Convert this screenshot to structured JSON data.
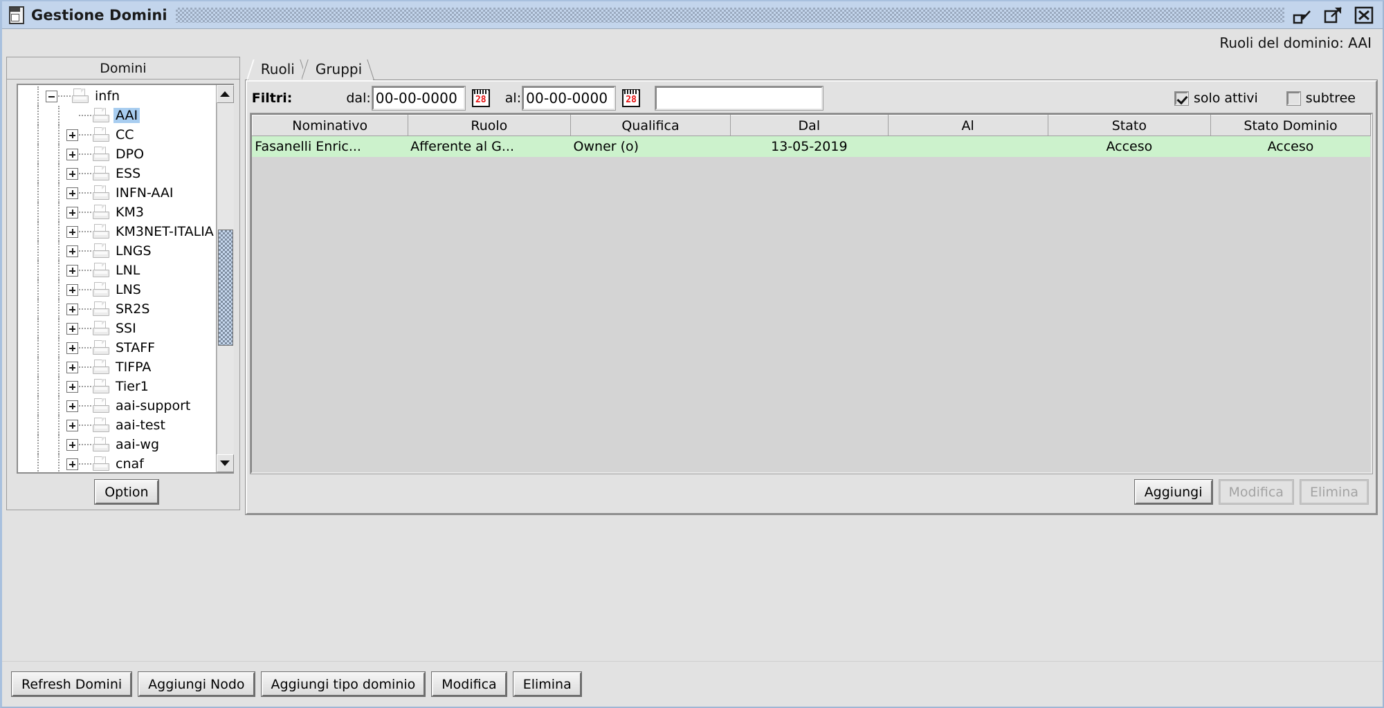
{
  "window": {
    "title": "Gestione Domini",
    "icon": "window-app-icon",
    "controls": [
      {
        "name": "minimize-icon",
        "label": "Minimize"
      },
      {
        "name": "maximize-icon",
        "label": "Maximize"
      },
      {
        "name": "close-icon",
        "label": "Close"
      }
    ]
  },
  "header": {
    "context_label": "Ruoli del dominio: AAI"
  },
  "left_panel": {
    "title": "Domini",
    "option_button": "Option",
    "tree": [
      {
        "label": "infn",
        "level": 0,
        "toggle": "minus",
        "selected": false
      },
      {
        "label": "AAI",
        "level": 1,
        "toggle": "none",
        "selected": true
      },
      {
        "label": "CC",
        "level": 1,
        "toggle": "plus",
        "selected": false
      },
      {
        "label": "DPO",
        "level": 1,
        "toggle": "plus",
        "selected": false
      },
      {
        "label": "ESS",
        "level": 1,
        "toggle": "plus",
        "selected": false
      },
      {
        "label": "INFN-AAI",
        "level": 1,
        "toggle": "plus",
        "selected": false
      },
      {
        "label": "KM3",
        "level": 1,
        "toggle": "plus",
        "selected": false
      },
      {
        "label": "KM3NET-ITALIA",
        "level": 1,
        "toggle": "plus",
        "selected": false
      },
      {
        "label": "LNGS",
        "level": 1,
        "toggle": "plus",
        "selected": false
      },
      {
        "label": "LNL",
        "level": 1,
        "toggle": "plus",
        "selected": false
      },
      {
        "label": "LNS",
        "level": 1,
        "toggle": "plus",
        "selected": false
      },
      {
        "label": "SR2S",
        "level": 1,
        "toggle": "plus",
        "selected": false
      },
      {
        "label": "SSI",
        "level": 1,
        "toggle": "plus",
        "selected": false
      },
      {
        "label": "STAFF",
        "level": 1,
        "toggle": "plus",
        "selected": false
      },
      {
        "label": "TIFPA",
        "level": 1,
        "toggle": "plus",
        "selected": false
      },
      {
        "label": "Tier1",
        "level": 1,
        "toggle": "plus",
        "selected": false
      },
      {
        "label": "aai-support",
        "level": 1,
        "toggle": "plus",
        "selected": false
      },
      {
        "label": "aai-test",
        "level": 1,
        "toggle": "plus",
        "selected": false
      },
      {
        "label": "aai-wg",
        "level": 1,
        "toggle": "plus",
        "selected": false
      },
      {
        "label": "cnaf",
        "level": 1,
        "toggle": "plus",
        "selected": false
      }
    ]
  },
  "right_panel": {
    "tabs": [
      {
        "label": "Ruoli",
        "active": true
      },
      {
        "label": "Gruppi",
        "active": false
      }
    ],
    "filters": {
      "title": "Filtri:",
      "from_label": "dal:",
      "from_value": "00-00-0000",
      "from_calendar_icon": "calendar-icon",
      "from_calendar_day": "28",
      "to_label": "al:",
      "to_value": "00-00-0000",
      "to_calendar_icon": "calendar-icon",
      "to_calendar_day": "28",
      "search_value": "",
      "search_placeholder": "",
      "only_active": {
        "label": "solo attivi",
        "checked": true
      },
      "subtree": {
        "label": "subtree",
        "checked": false
      }
    },
    "table": {
      "columns": [
        "Nominativo",
        "Ruolo",
        "Qualifica",
        "Dal",
        "Al",
        "Stato",
        "Stato Dominio"
      ],
      "rows": [
        {
          "cells": [
            "Fasanelli Enric...",
            "Afferente al G...",
            "Owner (o)",
            "13-05-2019",
            "",
            "Acceso",
            "Acceso"
          ],
          "row_color": "#ccf2cc"
        }
      ]
    },
    "buttons": [
      {
        "label": "Aggiungi",
        "enabled": true
      },
      {
        "label": "Modifica",
        "enabled": false
      },
      {
        "label": "Elimina",
        "enabled": false
      }
    ]
  },
  "bottom_toolbar": {
    "buttons": [
      {
        "label": "Refresh Domini"
      },
      {
        "label": "Aggiungi Nodo"
      },
      {
        "label": "Aggiungi tipo dominio"
      },
      {
        "label": "Modifica"
      },
      {
        "label": "Elimina"
      }
    ]
  },
  "colors": {
    "titlebar": "#c3d5ec",
    "window_bg": "#e2e2e2",
    "selection": "#a8cdf0",
    "row_green": "#ccf2cc",
    "calendar_red": "#e81111"
  }
}
